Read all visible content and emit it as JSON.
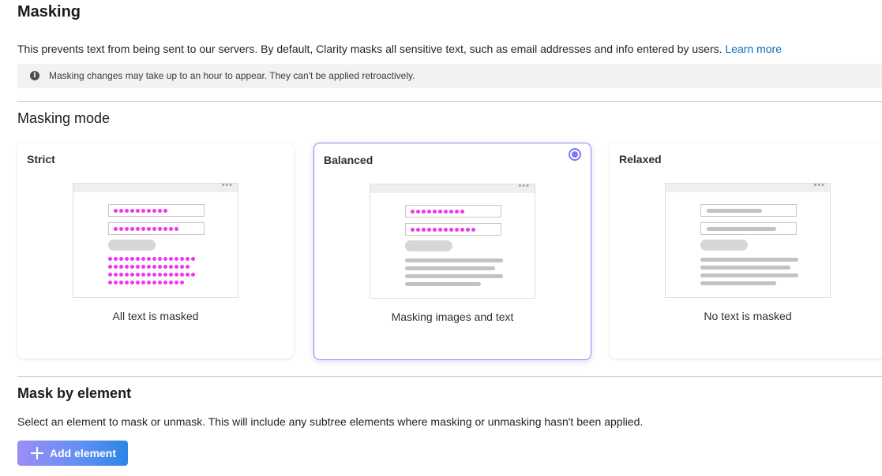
{
  "header": {
    "title": "Masking",
    "description": "This prevents text from being sent to our servers. By default, Clarity masks all sensitive text, such as email addresses and info entered by users.",
    "learn_more": "Learn more"
  },
  "banner": {
    "icon": "info-icon",
    "text": "Masking changes may take up to an hour to appear. They can't be applied retroactively."
  },
  "masking_mode": {
    "heading": "Masking mode",
    "selected": "Balanced",
    "options": [
      {
        "title": "Strict",
        "caption": "All text is masked"
      },
      {
        "title": "Balanced",
        "caption": "Masking images and text"
      },
      {
        "title": "Relaxed",
        "caption": "No text is masked"
      }
    ]
  },
  "mask_by_element": {
    "heading": "Mask by element",
    "description": "Select an element to mask or unmask. This will include any subtree elements where masking or unmasking hasn't been applied.",
    "add_button": "Add element"
  },
  "colors": {
    "accent": "#7f77f1",
    "mask_dots": "#ee38ee",
    "link": "#0f6cbd"
  }
}
